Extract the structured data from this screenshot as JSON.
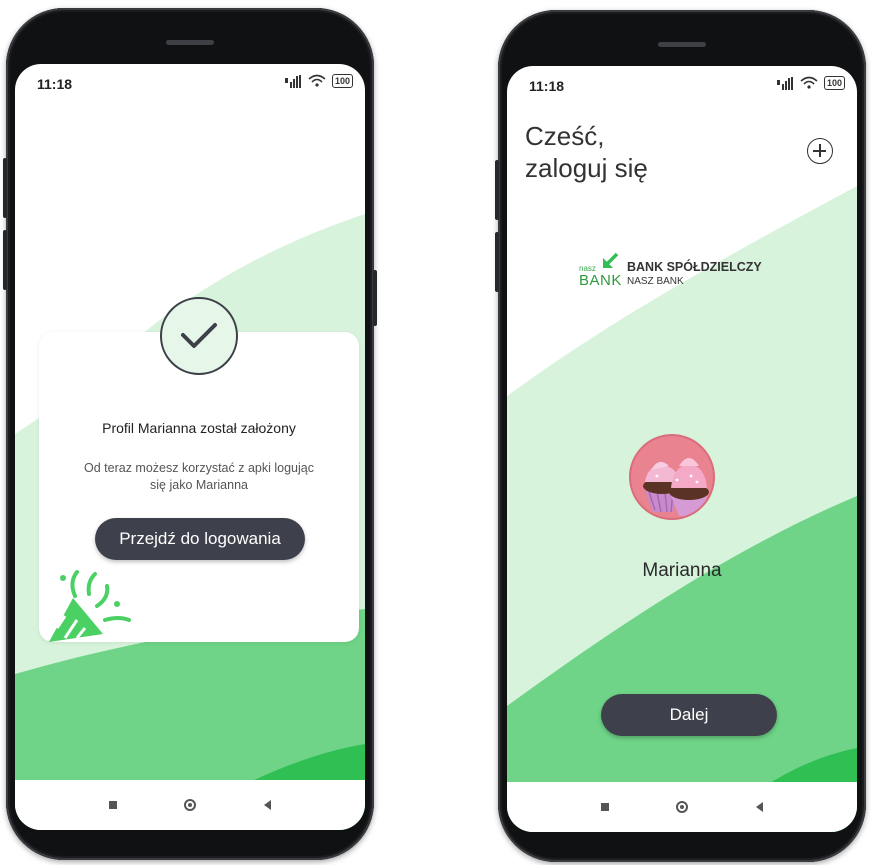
{
  "status_bar": {
    "time": "11:18",
    "battery": "100"
  },
  "success_screen": {
    "title": "Profil Marianna został założony",
    "subtitle": "Od teraz możesz korzystać z apki logując się jako Marianna",
    "login_button": "Przejdź do logowania"
  },
  "login_screen": {
    "greeting_line1": "Cześć,",
    "greeting_line2": "zaloguj się",
    "bank_logo": {
      "small": "nasz",
      "big": "BANK"
    },
    "bank_name_line1": "BANK SPÓŁDZIELCZY",
    "bank_name_line2": "NASZ BANK",
    "profile_name": "Marianna",
    "next_button": "Dalej"
  },
  "colors": {
    "light_green": "#d8f3dc",
    "mid_green": "#6fd487",
    "bright_green": "#2fbf53",
    "dark_button": "#3e414b"
  },
  "icons": {
    "success": "check-circle-icon",
    "celebration": "party-popper-icon",
    "add_profile": "plus-circle-icon",
    "avatar": "cupcake-avatar"
  }
}
